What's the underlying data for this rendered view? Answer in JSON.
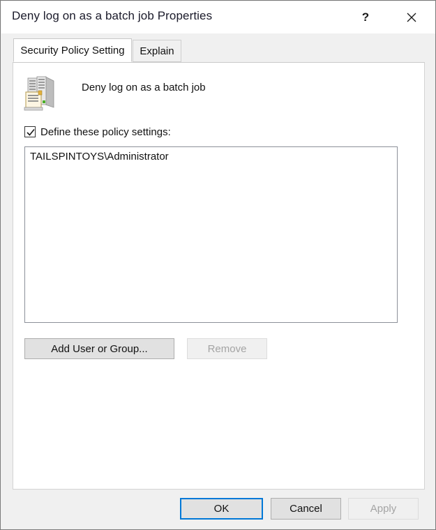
{
  "window": {
    "title": "Deny log on as a batch job Properties",
    "help_icon": "?",
    "close_icon": "close-icon"
  },
  "tabs": [
    {
      "id": "security-policy-setting",
      "label": "Security Policy Setting",
      "active": true
    },
    {
      "id": "explain",
      "label": "Explain",
      "active": false
    }
  ],
  "policy": {
    "icon": "server-policy-icon",
    "name": "Deny log on as a batch job"
  },
  "define_policy": {
    "label": "Define these policy settings:",
    "checked": true,
    "check_glyph": "checkmark-icon"
  },
  "principals": {
    "items": [
      "TAILSPINTOYS\\Administrator"
    ]
  },
  "actions": {
    "add_label": "Add User or Group...",
    "add_enabled": true,
    "remove_label": "Remove",
    "remove_enabled": false
  },
  "footer": {
    "ok_label": "OK",
    "cancel_label": "Cancel",
    "apply_label": "Apply",
    "apply_enabled": false,
    "default_button": "OK"
  },
  "colors": {
    "accent": "#0078d7",
    "dialog_face": "#f0f0f0",
    "panel": "#ffffff",
    "button_face": "#e1e1e1",
    "disabled_text": "#a4a4a4",
    "text": "#111111"
  }
}
